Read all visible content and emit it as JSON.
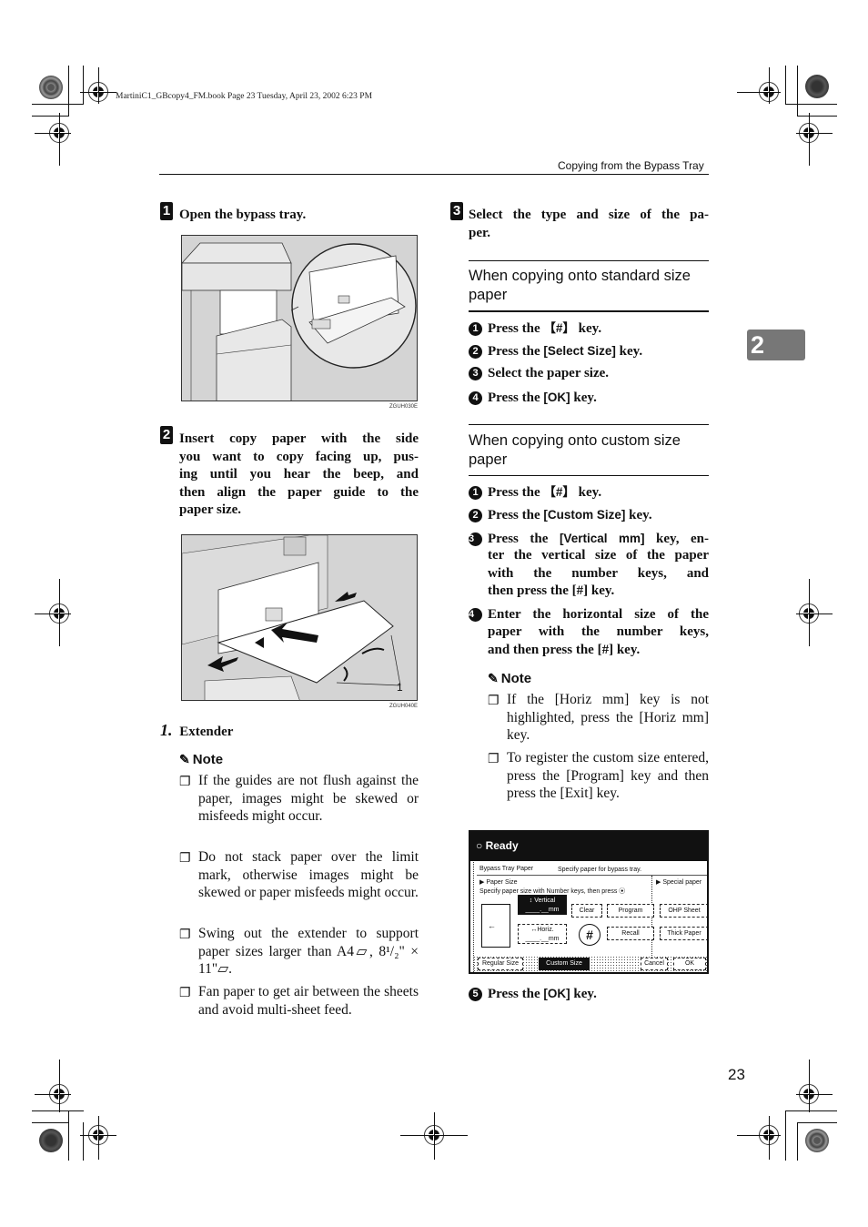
{
  "print_meta": {
    "book_line": "MartiniC1_GBcopy4_FM.book  Page 23  Tuesday, April 23, 2002  6:23 PM"
  },
  "header": {
    "running_title": "Copying from the Bypass Tray"
  },
  "chapter_tab": "2",
  "page_number": "23",
  "steps": [
    {
      "number": "1",
      "text": "Open the bypass tray.",
      "figure_code": "ZGUH030E"
    },
    {
      "number": "2",
      "text": "Insert copy paper with the side you want to copy facing up, pushing until you hear the beep, and then align the paper guide to the paper size.",
      "text_lines": [
        "Insert copy paper with the side",
        "you want to copy facing up, pus-",
        "ing until you hear the beep, and",
        "then align the paper guide to the",
        "paper size."
      ],
      "figure_code": "ZGUH040E",
      "figure_callout": "1",
      "callout_legend": {
        "number": "1.",
        "label": "Extender"
      },
      "note": {
        "title": "Note",
        "items": [
          "If the guides are not flush against the paper, images might be skewed or misfeeds might occur.",
          "Do not stack paper over the limit mark, otherwise images might be skewed or paper misfeeds might occur.",
          "Swing out the extender to support paper sizes larger than A4▱, 8¹/₂\" × 11\"▱.",
          "Fan paper to get air between the sheets and avoid multi-sheet feed."
        ]
      }
    },
    {
      "number": "3",
      "text_lines": [
        "Select the type and size of the pa-",
        "per."
      ],
      "text": "Select the type and size of the paper.",
      "sections": [
        {
          "heading_lines": [
            "When copying onto standard size",
            "paper"
          ],
          "substeps": [
            {
              "num": "1",
              "pre": "Press the ",
              "key": "【#】",
              "post": " key."
            },
            {
              "num": "2",
              "pre": "Press the ",
              "key": "[Select Size]",
              "post": " key."
            },
            {
              "num": "3",
              "pre": "Select the paper size.",
              "key": "",
              "post": ""
            },
            {
              "num": "4",
              "pre": "Press the ",
              "key": "[OK]",
              "post": " key."
            }
          ]
        },
        {
          "heading_lines": [
            "When copying onto custom size",
            "paper"
          ],
          "substeps": [
            {
              "num": "1",
              "pre": "Press the ",
              "key": "【#】",
              "post": " key."
            },
            {
              "num": "2",
              "pre": "Press the ",
              "key": "[Custom Size]",
              "post": " key."
            },
            {
              "num": "3",
              "pre": "Press the ",
              "key": "[Vertical mm]",
              "post": " key, en-",
              "cont": [
                "ter the vertical size of the paper",
                "with the number keys, and",
                "then press the [#] key."
              ]
            },
            {
              "num": "4",
              "pre": "Enter the horizontal size of the",
              "key": "",
              "post": "",
              "cont": [
                "paper with the number keys,",
                "and then press the [#] key."
              ]
            },
            {
              "num": "5",
              "pre": "Press the ",
              "key": "[OK]",
              "post": " key."
            }
          ],
          "note": {
            "title": "Note",
            "items": [
              "If the [Horiz mm] key is not highlighted, press the [Horiz mm] key.",
              "To register the custom size entered, press the [Program] key and then press the [Exit] key."
            ]
          }
        }
      ],
      "panel": {
        "status": "Ready",
        "title": "Bypass Tray Paper",
        "instruction": "Specify paper for bypass tray.",
        "paper_size_label": "▶ Paper Size",
        "paper_size_hint": "Specify paper size with Number keys, then press ⦿",
        "special_paper_label": "▶ Special paper",
        "vertical_label": "↕ Vertical",
        "vertical_value": "____.__mm",
        "horiz_label": "↔Horiz.",
        "horiz_value": "____.__mm",
        "hash_key": "#",
        "buttons": {
          "clear": "Clear",
          "program": "Program",
          "recall": "Recall",
          "ohp": "OHP Sheet",
          "thick": "Thick Paper",
          "regular": "Regular Size",
          "custom": "Custom Size",
          "cancel": "Cancel",
          "ok": "OK"
        }
      }
    }
  ]
}
